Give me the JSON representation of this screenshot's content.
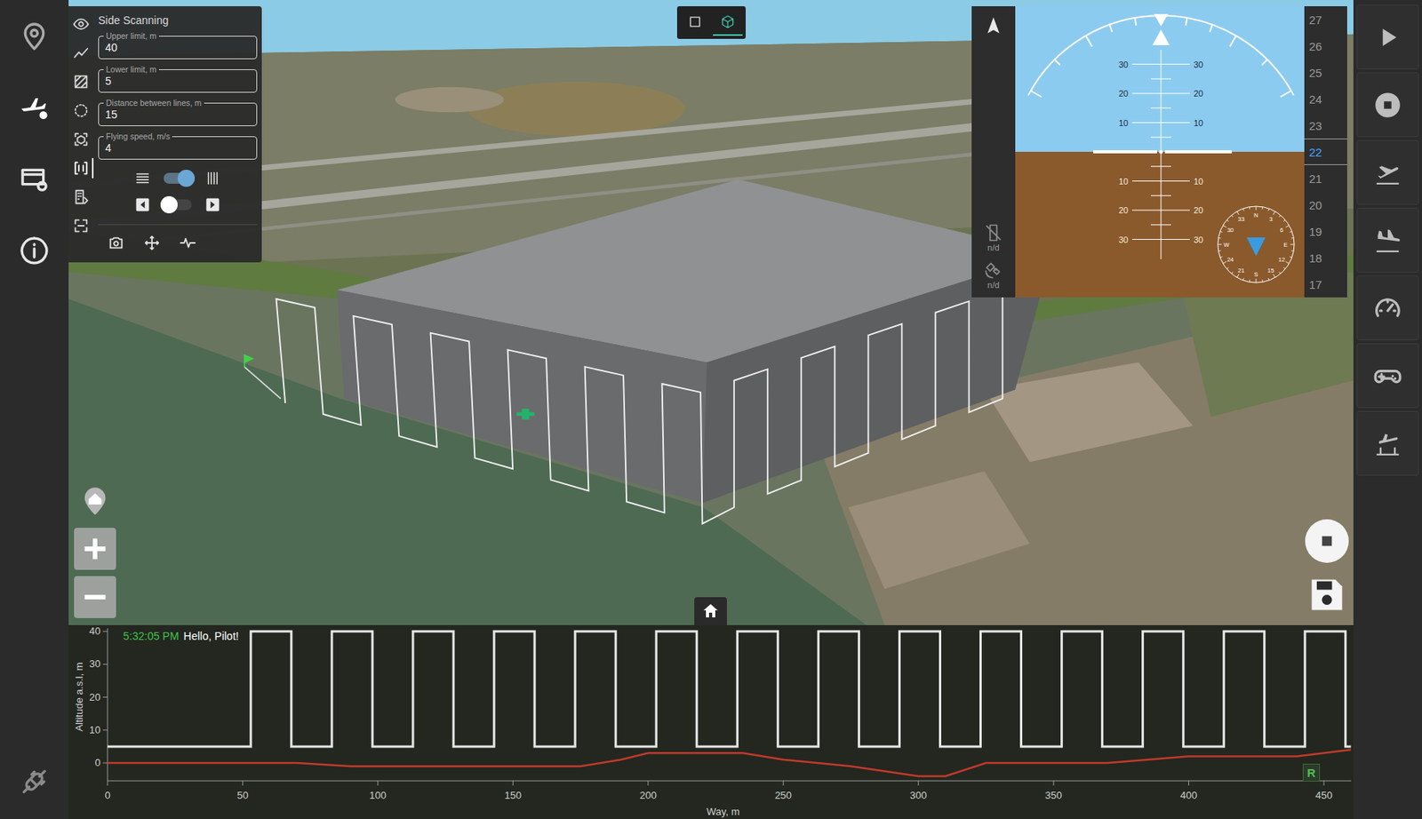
{
  "sidebar": {
    "items": [
      {
        "selected": false
      },
      {
        "selected": true
      },
      {
        "selected": false
      },
      {
        "selected": false
      }
    ]
  },
  "view_toggle": [
    {
      "selected": false
    },
    {
      "selected": true
    }
  ],
  "scan_panel": {
    "title": "Side Scanning",
    "tools": [
      {
        "selected": false
      },
      {
        "selected": false
      },
      {
        "selected": false
      },
      {
        "selected": false
      },
      {
        "selected": false
      },
      {
        "selected": true
      },
      {
        "selected": false
      },
      {
        "selected": false
      }
    ],
    "fields": [
      {
        "label": "Upper limit, m",
        "value": "40"
      },
      {
        "label": "Lower limit, m",
        "value": "5"
      },
      {
        "label": "Distance between lines, m",
        "value": "15"
      },
      {
        "label": "Flying speed, m/s",
        "value": "4"
      }
    ],
    "direction_switch": {
      "on": true
    },
    "side_switch": {
      "on": false
    }
  },
  "attitude": {
    "pitch_up": [
      "30",
      "20",
      "10"
    ],
    "pitch_down": [
      "10",
      "20",
      "30"
    ],
    "compass": [
      "N",
      "3",
      "6",
      "E",
      "12",
      "15",
      "S",
      "21",
      "24",
      "W",
      "30",
      "33"
    ],
    "telemetry": [
      {
        "reading": "n/d"
      },
      {
        "reading": "n/d"
      }
    ],
    "altitude_tape": [
      {
        "value": "27",
        "selected": false
      },
      {
        "value": "26",
        "selected": false
      },
      {
        "value": "25",
        "selected": false
      },
      {
        "value": "24",
        "selected": false
      },
      {
        "value": "23",
        "selected": false
      },
      {
        "value": "22",
        "selected": true
      },
      {
        "value": "21",
        "selected": false
      },
      {
        "value": "20",
        "selected": false
      },
      {
        "value": "19",
        "selected": false
      },
      {
        "value": "18",
        "selected": false
      },
      {
        "value": "17",
        "selected": false
      }
    ]
  },
  "chart": {
    "message": {
      "time": "5:32:05 PM",
      "text": "Hello, Pilot!"
    },
    "y_label": "Altitude a.s.l, m",
    "x_label": "Way, m",
    "y_ticks": [
      "40",
      "30",
      "20",
      "10",
      "0"
    ],
    "x_ticks": [
      "0",
      "50",
      "100",
      "150",
      "200",
      "250",
      "300",
      "350",
      "400",
      "450"
    ],
    "corner_badge": "R",
    "series": [
      {
        "color": "#e6e6e6",
        "way": [
          0,
          53,
          53,
          68,
          68,
          83,
          83,
          98,
          98,
          113,
          113,
          128,
          128,
          143,
          143,
          158,
          158,
          173,
          173,
          188,
          188,
          203,
          203,
          218,
          218,
          233,
          233,
          248,
          248,
          263,
          263,
          278,
          278,
          293,
          293,
          308,
          308,
          323,
          323,
          338,
          338,
          353,
          353,
          368,
          368,
          383,
          383,
          398,
          398,
          413,
          413,
          428,
          428,
          443,
          443,
          458,
          458,
          460
        ],
        "altitude": [
          5,
          5,
          40,
          40,
          5,
          5,
          40,
          40,
          5,
          5,
          40,
          40,
          5,
          5,
          40,
          40,
          5,
          5,
          40,
          40,
          5,
          5,
          40,
          40,
          5,
          5,
          40,
          40,
          5,
          5,
          40,
          40,
          5,
          5,
          40,
          40,
          5,
          5,
          40,
          40,
          5,
          5,
          40,
          40,
          5,
          5,
          40,
          40,
          5,
          5,
          40,
          40,
          5,
          5,
          40,
          40,
          5,
          5
        ]
      },
      {
        "color": "#c0392b",
        "way": [
          0,
          70,
          90,
          175,
          190,
          200,
          235,
          250,
          275,
          300,
          310,
          325,
          370,
          400,
          440,
          460
        ],
        "altitude": [
          0,
          0,
          -1,
          -1,
          1,
          3,
          3,
          1,
          -1,
          -4,
          -4,
          0,
          0,
          2,
          2,
          4
        ]
      }
    ]
  }
}
